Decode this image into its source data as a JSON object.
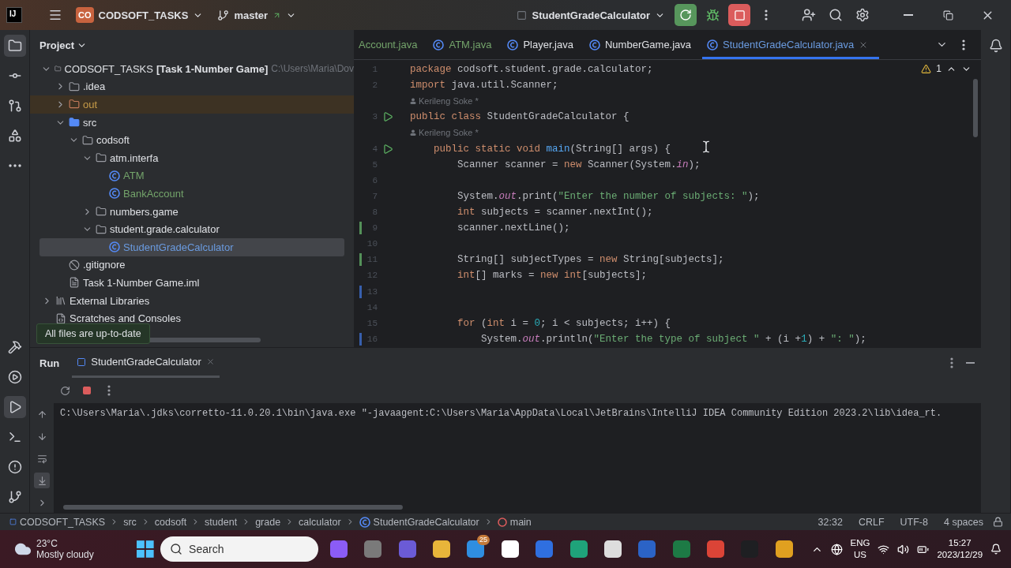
{
  "titlebar": {
    "app_logo": "IJ",
    "project_badge": "CO",
    "project": "CODSOFT_TASKS",
    "branch": "master",
    "run_config": "StudentGradeCalculator"
  },
  "project_panel": {
    "title": "Project",
    "tooltip": "All files are up-to-date",
    "tree": [
      {
        "label": "CODSOFT_TASKS",
        "suffix": "[Task 1-Number Game]",
        "path": "C:\\Users\\Maria\\Dov",
        "kind": "module",
        "expanded": true,
        "selected": false,
        "children": [
          {
            "label": ".idea",
            "kind": "folder",
            "expanded": false,
            "selected": false
          },
          {
            "label": "out",
            "kind": "excluded",
            "color": "#c69b48",
            "expanded": false,
            "selected": false
          },
          {
            "label": "src",
            "kind": "source",
            "expanded": true,
            "selected": false,
            "children": [
              {
                "label": "codsoft",
                "kind": "package",
                "expanded": true,
                "selected": false,
                "children": [
                  {
                    "label": "atm.interfa",
                    "kind": "package",
                    "expanded": true,
                    "selected": false,
                    "children": [
                      {
                        "label": "ATM",
                        "kind": "class",
                        "color": "#73a36a",
                        "selected": false
                      },
                      {
                        "label": "BankAccount",
                        "kind": "class",
                        "color": "#73a36a",
                        "selected": false
                      }
                    ]
                  },
                  {
                    "label": "numbers.game",
                    "kind": "package",
                    "expanded": false,
                    "selected": false
                  },
                  {
                    "label": "student.grade.calculator",
                    "kind": "package",
                    "expanded": true,
                    "selected": false,
                    "children": [
                      {
                        "label": "StudentGradeCalculator",
                        "kind": "class",
                        "color": "#6a9be0",
                        "selected": true
                      }
                    ]
                  }
                ]
              }
            ]
          },
          {
            "label": ".gitignore",
            "kind": "ignore",
            "selected": false
          },
          {
            "label": "Task 1-Number Game.iml",
            "kind": "file",
            "selected": false
          }
        ]
      },
      {
        "label": "External Libraries",
        "kind": "library",
        "expanded": false,
        "selected": false
      },
      {
        "label": "Scratches and Consoles",
        "kind": "scratches",
        "selected": false
      }
    ]
  },
  "editor": {
    "tabs": [
      {
        "label": "Account.java",
        "color": "#73a36a",
        "selected": false
      },
      {
        "label": "ATM.java",
        "color": "#73a36a",
        "selected": false
      },
      {
        "label": "Player.java",
        "selected": false
      },
      {
        "label": "NumberGame.java",
        "selected": false
      },
      {
        "label": "StudentGradeCalculator.java",
        "color": "#6a9be0",
        "selected": true
      }
    ],
    "warnings": "1",
    "lines": [
      {
        "number": "1",
        "tokens": [
          {
            "color": "#cf8e6d",
            "t": "package"
          },
          {
            "color": "#bcbec4",
            "t": " codsoft.student.grade.calculator;"
          }
        ]
      },
      {
        "number": "2",
        "tokens": [
          {
            "color": "#cf8e6d",
            "t": "import"
          },
          {
            "color": "#bcbec4",
            "t": " java.util.Scanner;"
          }
        ]
      },
      {
        "number": "3",
        "author": "Kerileng Soke *",
        "run": true,
        "tokens": [
          {
            "color": "#cf8e6d",
            "t": "public class"
          },
          {
            "color": "#bcbec4",
            "t": " StudentGradeCalculator {"
          }
        ]
      },
      {
        "number": "4",
        "author": "Kerileng Soke *",
        "run": true,
        "tokens": [
          {
            "color": "#cf8e6d",
            "t": "    public static void"
          },
          {
            "color": "#56a8f5",
            "t": " main"
          },
          {
            "color": "#bcbec4",
            "t": "(String[] args) {"
          }
        ]
      },
      {
        "number": "5",
        "tokens": [
          {
            "color": "#bcbec4",
            "t": "        Scanner scanner = "
          },
          {
            "color": "#cf8e6d",
            "t": "new"
          },
          {
            "color": "#bcbec4",
            "t": " Scanner(System."
          },
          {
            "color": "#c77dbb",
            "italic": true,
            "t": "in"
          },
          {
            "color": "#bcbec4",
            "t": ");"
          }
        ]
      },
      {
        "number": "6"
      },
      {
        "number": "7",
        "tokens": [
          {
            "color": "#bcbec4",
            "t": "        System."
          },
          {
            "color": "#c77dbb",
            "italic": true,
            "t": "out"
          },
          {
            "color": "#bcbec4",
            "t": ".print("
          },
          {
            "color": "#6aab73",
            "t": "\"Enter the number of subjects: \""
          },
          {
            "color": "#bcbec4",
            "t": ");"
          }
        ]
      },
      {
        "number": "8",
        "tokens": [
          {
            "color": "#cf8e6d",
            "t": "        int"
          },
          {
            "color": "#bcbec4",
            "t": " subjects = scanner.nextInt();"
          }
        ]
      },
      {
        "number": "9",
        "marker": {
          "color": "#549159"
        },
        "tokens": [
          {
            "color": "#bcbec4",
            "t": "        scanner.nextLine();"
          }
        ]
      },
      {
        "number": "10"
      },
      {
        "number": "11",
        "marker": {
          "color": "#549159"
        },
        "tokens": [
          {
            "color": "#bcbec4",
            "t": "        String[] subjectTypes = "
          },
          {
            "color": "#cf8e6d",
            "t": "new"
          },
          {
            "color": "#bcbec4",
            "t": " String[subjects];"
          }
        ]
      },
      {
        "number": "12",
        "tokens": [
          {
            "color": "#cf8e6d",
            "t": "        int"
          },
          {
            "color": "#bcbec4",
            "t": "[] marks = "
          },
          {
            "color": "#cf8e6d",
            "t": "new int"
          },
          {
            "color": "#bcbec4",
            "t": "[subjects];"
          }
        ]
      },
      {
        "number": "13",
        "marker": {
          "color": "#375fad"
        }
      },
      {
        "number": "14"
      },
      {
        "number": "15",
        "tokens": [
          {
            "color": "#cf8e6d",
            "t": "        for"
          },
          {
            "color": "#bcbec4",
            "t": " ("
          },
          {
            "color": "#cf8e6d",
            "t": "int"
          },
          {
            "color": "#bcbec4",
            "t": " i = "
          },
          {
            "color": "#2aacb8",
            "t": "0"
          },
          {
            "color": "#bcbec4",
            "t": "; i < subjects; i++) {"
          }
        ]
      },
      {
        "number": "16",
        "marker": {
          "color": "#375fad"
        },
        "tokens": [
          {
            "color": "#bcbec4",
            "t": "            System."
          },
          {
            "color": "#c77dbb",
            "italic": true,
            "t": "out"
          },
          {
            "color": "#bcbec4",
            "t": ".println("
          },
          {
            "color": "#6aab73",
            "t": "\"Enter the type of subject \""
          },
          {
            "color": "#bcbec4",
            "t": " + (i +"
          },
          {
            "color": "#2aacb8",
            "t": "1"
          },
          {
            "color": "#bcbec4",
            "t": ") + "
          },
          {
            "color": "#6aab73",
            "t": "\": \""
          },
          {
            "color": "#bcbec4",
            "t": ");"
          }
        ]
      }
    ]
  },
  "run_panel": {
    "title": "Run",
    "tabs": [
      {
        "label": "StudentGradeCalculator",
        "selected": true
      }
    ],
    "console": [
      "C:\\Users\\Maria\\.jdks\\corretto-11.0.20.1\\bin\\java.exe \"-javaagent:C:\\Users\\Maria\\AppData\\Local\\JetBrains\\IntelliJ IDEA Community Edition 2023.2\\lib\\idea_rt."
    ]
  },
  "status_bar": {
    "breadcrumbs": [
      {
        "label": "CODSOFT_TASKS",
        "kind": "module"
      },
      {
        "label": "src",
        "kind": "plain"
      },
      {
        "label": "codsoft",
        "kind": "plain"
      },
      {
        "label": "student",
        "kind": "plain"
      },
      {
        "label": "grade",
        "kind": "plain"
      },
      {
        "label": "calculator",
        "kind": "plain"
      },
      {
        "label": "StudentGradeCalculator",
        "kind": "class"
      },
      {
        "label": "main",
        "kind": "method"
      }
    ],
    "position": "32:32",
    "line_separator": "CRLF",
    "encoding": "UTF-8",
    "indent": "4 spaces"
  },
  "taskbar": {
    "temperature": "23°C",
    "weather": "Mostly cloudy",
    "search_placeholder": "Search",
    "mail_badge": "25",
    "language": "ENG",
    "region": "US",
    "time": "15:27",
    "date": "2023/12/29"
  }
}
